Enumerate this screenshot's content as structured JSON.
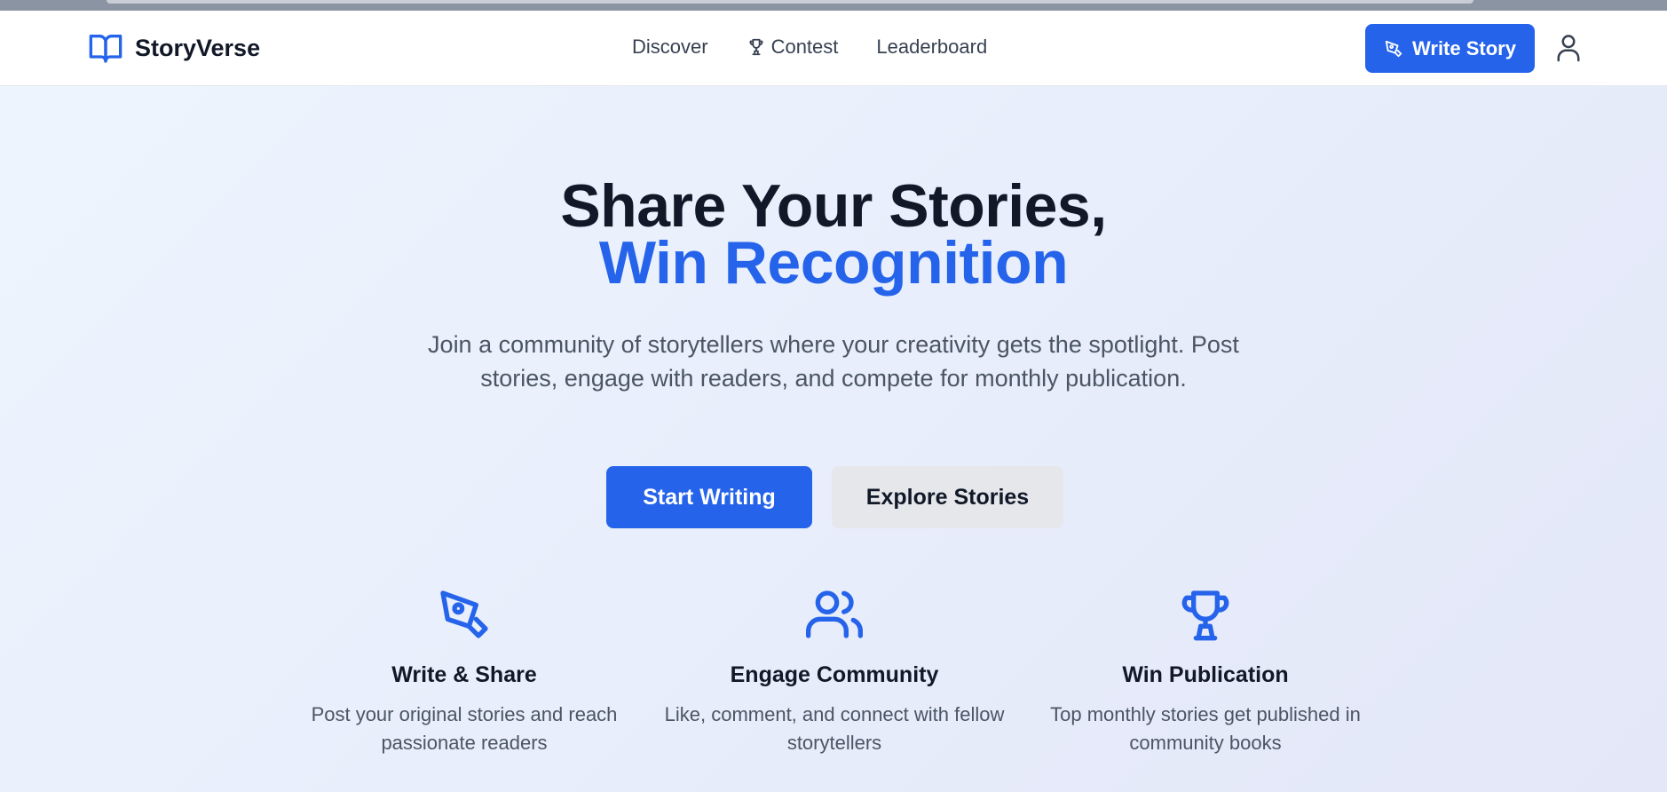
{
  "nav": {
    "brand": "StoryVerse",
    "links": [
      {
        "label": "Discover"
      },
      {
        "label": "Contest"
      },
      {
        "label": "Leaderboard"
      }
    ],
    "write_button": "Write Story"
  },
  "hero": {
    "title_line1": "Share Your Stories,",
    "title_line2": "Win Recognition",
    "subtitle": "Join a community of storytellers where your creativity gets the spotlight. Post stories, engage with readers, and compete for monthly publication.",
    "primary_button": "Start Writing",
    "secondary_button": "Explore Stories"
  },
  "features": [
    {
      "icon": "pen-nib-icon",
      "title": "Write & Share",
      "description": "Post your original stories and reach passionate readers"
    },
    {
      "icon": "users-icon",
      "title": "Engage Community",
      "description": "Like, comment, and connect with fellow storytellers"
    },
    {
      "icon": "trophy-icon",
      "title": "Win Publication",
      "description": "Top monthly stories get published in community books"
    }
  ],
  "colors": {
    "accent": "#2563eb",
    "heading": "#111827",
    "body_text": "#4b5563"
  }
}
